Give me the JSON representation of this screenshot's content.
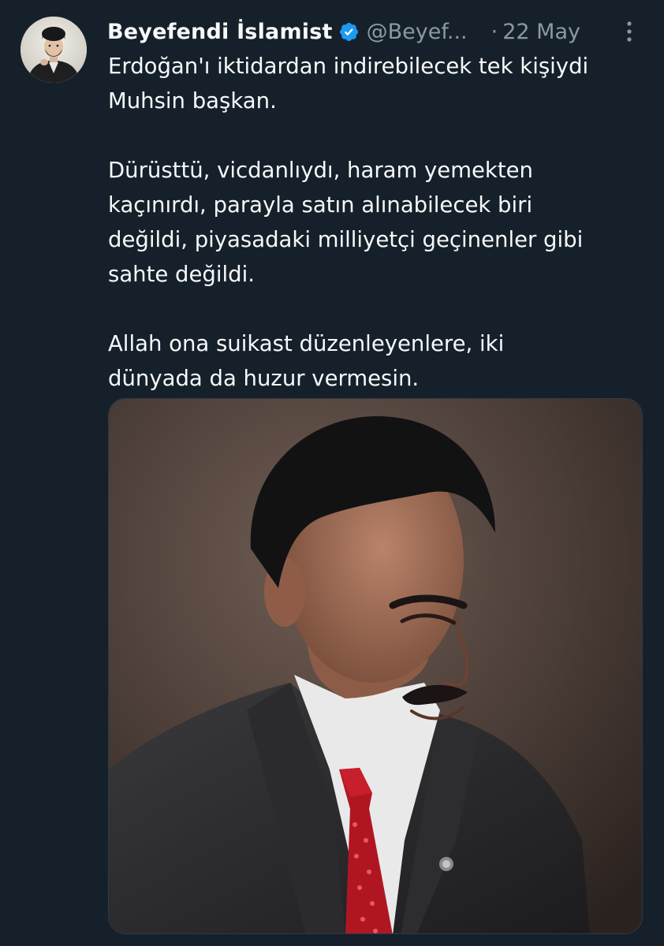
{
  "tweet": {
    "author": {
      "display_name": "Beyefendi İslamist",
      "handle": "@Beyef...",
      "verified": true,
      "avatar_icon": "profile-photo-icon"
    },
    "dot": "·",
    "timestamp": "22 May",
    "more_icon": "more-options-icon",
    "text_paragraphs": [
      [
        "Erdoğan'ı iktidardan indirebilecek tek kişiydi",
        "Muhsin başkan."
      ],
      [
        "Dürüsttü, vicdanlıydı, haram yemekten",
        "kaçınırdı, parayla satın alınabilecek biri",
        "değildi, piyasadaki milliyetçi geçinenler gibi",
        "sahte değildi."
      ],
      [
        "Allah ona suikast düzenleyenlere, iki",
        "dünyada da huzur vermesin."
      ]
    ],
    "media": {
      "type": "photo",
      "subject": "portrait-photo"
    }
  },
  "colors": {
    "background": "#15202b",
    "primary_text": "#f7f9f9",
    "secondary_text": "#8b98a5",
    "verified_badge": "#1d9bf0"
  }
}
